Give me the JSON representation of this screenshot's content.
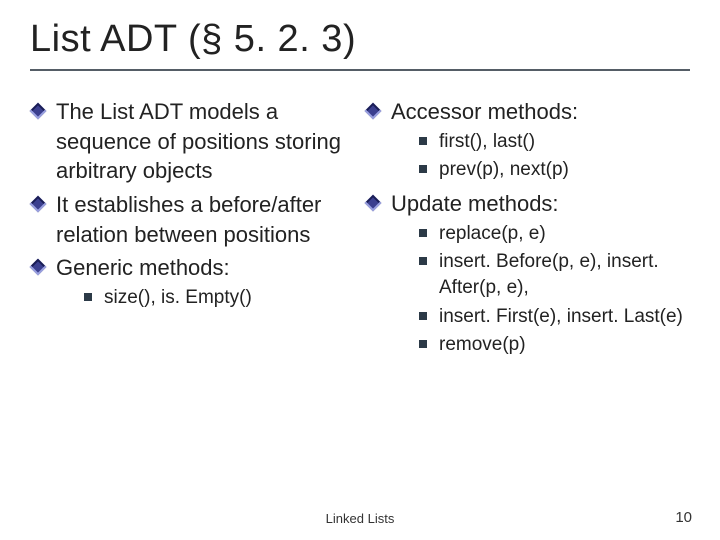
{
  "title": "List ADT (§ 5. 2. 3)",
  "left": {
    "item1": "The List ADT models a sequence of positions storing arbitrary objects",
    "item2": "It establishes a before/after relation between positions",
    "item3": "Generic methods:",
    "sub1": "size(), is. Empty()"
  },
  "right": {
    "item1": "Accessor methods:",
    "acc1": "first(), last()",
    "acc2": "prev(p), next(p)",
    "item2": "Update methods:",
    "upd1": "replace(p, e)",
    "upd2": "insert. Before(p, e), insert. After(p, e),",
    "upd3": "insert. First(e), insert. Last(e)",
    "upd4": "remove(p)"
  },
  "footer_center": "Linked Lists",
  "footer_right": "10"
}
